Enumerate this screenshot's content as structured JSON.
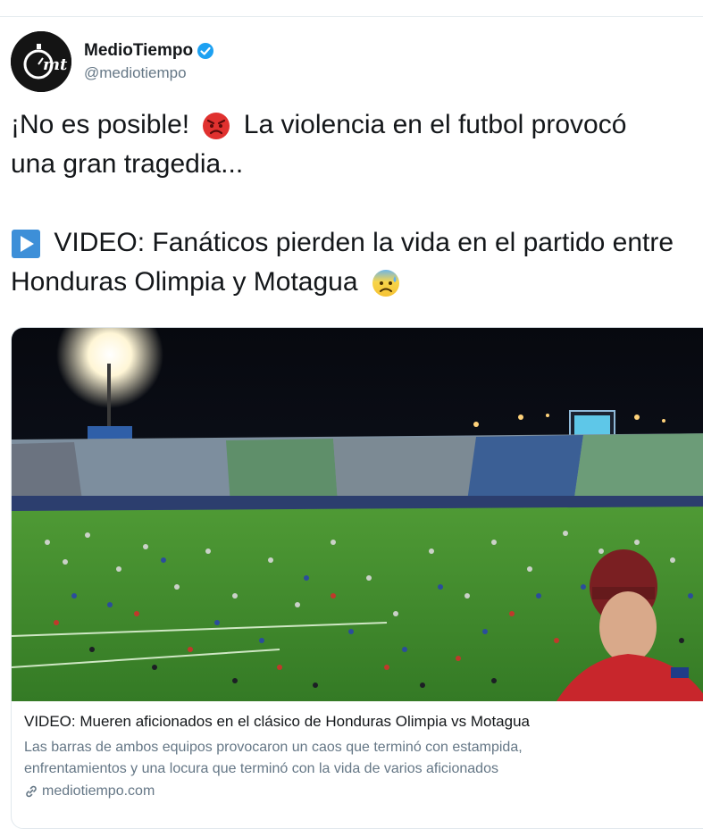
{
  "account": {
    "display_name": "MedioTiempo",
    "handle": "@mediotiempo",
    "avatar_text": "mt",
    "verified": true
  },
  "tweet": {
    "line1_a": "¡No es posible!",
    "line1_emoji": "angry-face-emoji",
    "line1_b": "La violencia en el futbol provocó",
    "line2": "una gran tragedia...",
    "line3_icon": "play-button-emoji",
    "line3": "VIDEO: Fanáticos pierden la vida en el partido entre",
    "line4": "Honduras Olimpia y Motagua",
    "line4_emoji": "anxious-face-with-sweat-emoji"
  },
  "card": {
    "image_icon": "stadium-crowd-photo",
    "title": "VIDEO: Mueren aficionados en el clásico de Honduras Olimpia vs Motagua",
    "description_line1": "Las barras de ambos equipos provocaron un caos que terminó con estampida,",
    "description_line2": "enfrentamientos y una locura que terminó con la vida de varios aficionados",
    "domain_icon": "link-icon",
    "domain": "mediotiempo.com"
  },
  "colors": {
    "text": "#14171a",
    "secondary": "#657786",
    "verified_blue": "#1da1f2",
    "border": "#e1e8ed",
    "pitch_green": "#3e8a2c",
    "night_sky": "#0b0e14"
  }
}
